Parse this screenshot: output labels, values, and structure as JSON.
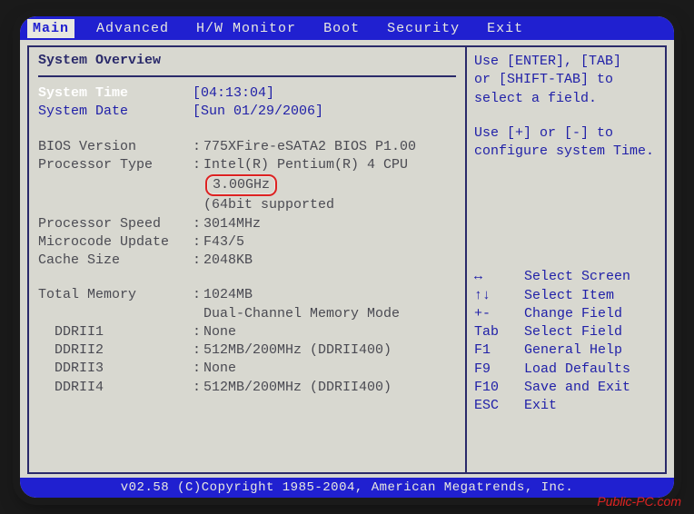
{
  "menu": {
    "items": [
      "Main",
      "Advanced",
      "H/W Monitor",
      "Boot",
      "Security",
      "Exit"
    ],
    "active_index": 0
  },
  "overview": {
    "title": "System Overview",
    "time_label": "System Time",
    "time_value": "[04:13:04]",
    "date_label": "System Date",
    "date_value": "[Sun 01/29/2006]",
    "bios_label": "BIOS Version",
    "bios_value": "775XFire-eSATA2 BIOS P1.00",
    "proc_type_label": "Processor Type",
    "proc_type_value": "Intel(R) Pentium(R) 4 CPU",
    "proc_freq_highlight": "3.00GHz",
    "proc_64": "(64bit supported",
    "proc_speed_label": "Processor Speed",
    "proc_speed_value": "3014MHz",
    "microcode_label": "Microcode Update",
    "microcode_value": "F43/5",
    "cache_label": "Cache Size",
    "cache_value": "2048KB",
    "mem_label": "Total Memory",
    "mem_value": "1024MB",
    "mem_mode": "Dual-Channel Memory Mode",
    "slots": [
      {
        "label": "DDRII1",
        "value": "None"
      },
      {
        "label": "DDRII2",
        "value": "512MB/200MHz (DDRII400)"
      },
      {
        "label": "DDRII3",
        "value": "None"
      },
      {
        "label": "DDRII4",
        "value": "512MB/200MHz (DDRII400)"
      }
    ]
  },
  "help": {
    "line1": "Use [ENTER], [TAB]",
    "line2": "or [SHIFT-TAB] to",
    "line3": "select a field.",
    "line4": "Use [+] or [-] to",
    "line5": "configure system Time."
  },
  "keys": [
    {
      "k": "↔",
      "d": "Select Screen"
    },
    {
      "k": "↑↓",
      "d": "Select Item"
    },
    {
      "k": "+-",
      "d": "Change Field"
    },
    {
      "k": "Tab",
      "d": "Select Field"
    },
    {
      "k": "F1",
      "d": "General Help"
    },
    {
      "k": "F9",
      "d": "Load Defaults"
    },
    {
      "k": "F10",
      "d": "Save and Exit"
    },
    {
      "k": "ESC",
      "d": "Exit"
    }
  ],
  "footer": "v02.58 (C)Copyright 1985-2004, American Megatrends, Inc.",
  "watermark": "Public-PC.com"
}
